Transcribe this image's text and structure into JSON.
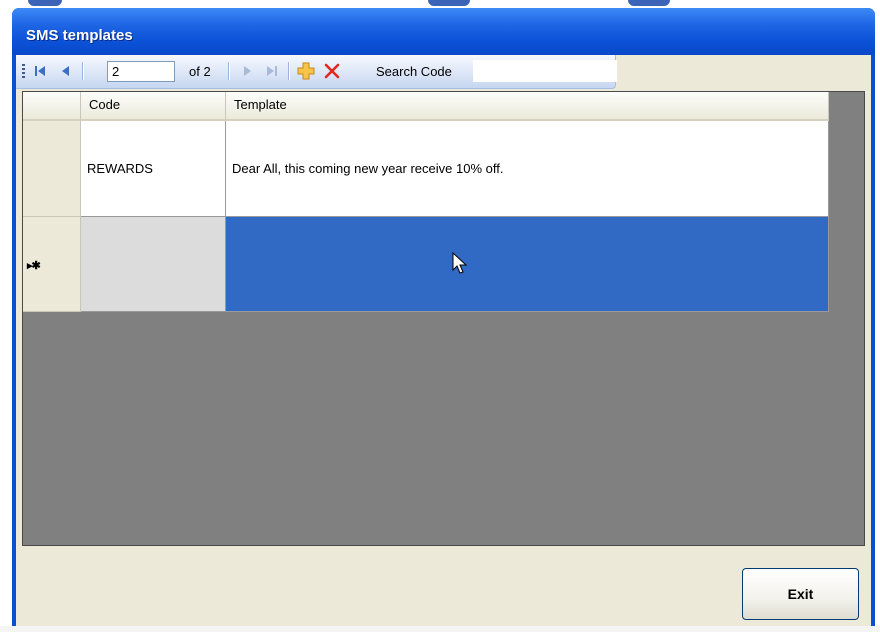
{
  "window": {
    "title": "SMS templates"
  },
  "toolbar": {
    "position_value": "2",
    "of_label": "of 2",
    "search_label": "Search Code",
    "search_value": ""
  },
  "grid": {
    "columns": [
      "Code",
      "Template"
    ],
    "rows": [
      {
        "code": "REWARDS",
        "template": "Dear All, this coming new year receive 10% off."
      }
    ],
    "new_row_indicator": "▸✱",
    "selection_color": "#316ac5"
  },
  "footer": {
    "exit_label": "Exit"
  }
}
